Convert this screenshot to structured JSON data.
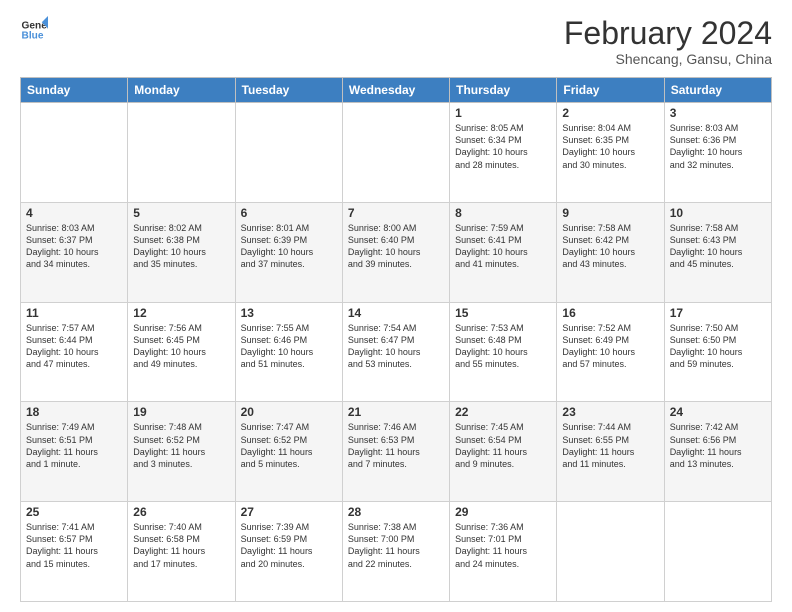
{
  "logo": {
    "line1": "General",
    "line2": "Blue"
  },
  "header": {
    "title": "February 2024",
    "subtitle": "Shencang, Gansu, China"
  },
  "weekdays": [
    "Sunday",
    "Monday",
    "Tuesday",
    "Wednesday",
    "Thursday",
    "Friday",
    "Saturday"
  ],
  "weeks": [
    [
      {
        "day": "",
        "info": ""
      },
      {
        "day": "",
        "info": ""
      },
      {
        "day": "",
        "info": ""
      },
      {
        "day": "",
        "info": ""
      },
      {
        "day": "1",
        "info": "Sunrise: 8:05 AM\nSunset: 6:34 PM\nDaylight: 10 hours\nand 28 minutes."
      },
      {
        "day": "2",
        "info": "Sunrise: 8:04 AM\nSunset: 6:35 PM\nDaylight: 10 hours\nand 30 minutes."
      },
      {
        "day": "3",
        "info": "Sunrise: 8:03 AM\nSunset: 6:36 PM\nDaylight: 10 hours\nand 32 minutes."
      }
    ],
    [
      {
        "day": "4",
        "info": "Sunrise: 8:03 AM\nSunset: 6:37 PM\nDaylight: 10 hours\nand 34 minutes."
      },
      {
        "day": "5",
        "info": "Sunrise: 8:02 AM\nSunset: 6:38 PM\nDaylight: 10 hours\nand 35 minutes."
      },
      {
        "day": "6",
        "info": "Sunrise: 8:01 AM\nSunset: 6:39 PM\nDaylight: 10 hours\nand 37 minutes."
      },
      {
        "day": "7",
        "info": "Sunrise: 8:00 AM\nSunset: 6:40 PM\nDaylight: 10 hours\nand 39 minutes."
      },
      {
        "day": "8",
        "info": "Sunrise: 7:59 AM\nSunset: 6:41 PM\nDaylight: 10 hours\nand 41 minutes."
      },
      {
        "day": "9",
        "info": "Sunrise: 7:58 AM\nSunset: 6:42 PM\nDaylight: 10 hours\nand 43 minutes."
      },
      {
        "day": "10",
        "info": "Sunrise: 7:58 AM\nSunset: 6:43 PM\nDaylight: 10 hours\nand 45 minutes."
      }
    ],
    [
      {
        "day": "11",
        "info": "Sunrise: 7:57 AM\nSunset: 6:44 PM\nDaylight: 10 hours\nand 47 minutes."
      },
      {
        "day": "12",
        "info": "Sunrise: 7:56 AM\nSunset: 6:45 PM\nDaylight: 10 hours\nand 49 minutes."
      },
      {
        "day": "13",
        "info": "Sunrise: 7:55 AM\nSunset: 6:46 PM\nDaylight: 10 hours\nand 51 minutes."
      },
      {
        "day": "14",
        "info": "Sunrise: 7:54 AM\nSunset: 6:47 PM\nDaylight: 10 hours\nand 53 minutes."
      },
      {
        "day": "15",
        "info": "Sunrise: 7:53 AM\nSunset: 6:48 PM\nDaylight: 10 hours\nand 55 minutes."
      },
      {
        "day": "16",
        "info": "Sunrise: 7:52 AM\nSunset: 6:49 PM\nDaylight: 10 hours\nand 57 minutes."
      },
      {
        "day": "17",
        "info": "Sunrise: 7:50 AM\nSunset: 6:50 PM\nDaylight: 10 hours\nand 59 minutes."
      }
    ],
    [
      {
        "day": "18",
        "info": "Sunrise: 7:49 AM\nSunset: 6:51 PM\nDaylight: 11 hours\nand 1 minute."
      },
      {
        "day": "19",
        "info": "Sunrise: 7:48 AM\nSunset: 6:52 PM\nDaylight: 11 hours\nand 3 minutes."
      },
      {
        "day": "20",
        "info": "Sunrise: 7:47 AM\nSunset: 6:52 PM\nDaylight: 11 hours\nand 5 minutes."
      },
      {
        "day": "21",
        "info": "Sunrise: 7:46 AM\nSunset: 6:53 PM\nDaylight: 11 hours\nand 7 minutes."
      },
      {
        "day": "22",
        "info": "Sunrise: 7:45 AM\nSunset: 6:54 PM\nDaylight: 11 hours\nand 9 minutes."
      },
      {
        "day": "23",
        "info": "Sunrise: 7:44 AM\nSunset: 6:55 PM\nDaylight: 11 hours\nand 11 minutes."
      },
      {
        "day": "24",
        "info": "Sunrise: 7:42 AM\nSunset: 6:56 PM\nDaylight: 11 hours\nand 13 minutes."
      }
    ],
    [
      {
        "day": "25",
        "info": "Sunrise: 7:41 AM\nSunset: 6:57 PM\nDaylight: 11 hours\nand 15 minutes."
      },
      {
        "day": "26",
        "info": "Sunrise: 7:40 AM\nSunset: 6:58 PM\nDaylight: 11 hours\nand 17 minutes."
      },
      {
        "day": "27",
        "info": "Sunrise: 7:39 AM\nSunset: 6:59 PM\nDaylight: 11 hours\nand 20 minutes."
      },
      {
        "day": "28",
        "info": "Sunrise: 7:38 AM\nSunset: 7:00 PM\nDaylight: 11 hours\nand 22 minutes."
      },
      {
        "day": "29",
        "info": "Sunrise: 7:36 AM\nSunset: 7:01 PM\nDaylight: 11 hours\nand 24 minutes."
      },
      {
        "day": "",
        "info": ""
      },
      {
        "day": "",
        "info": ""
      }
    ]
  ]
}
